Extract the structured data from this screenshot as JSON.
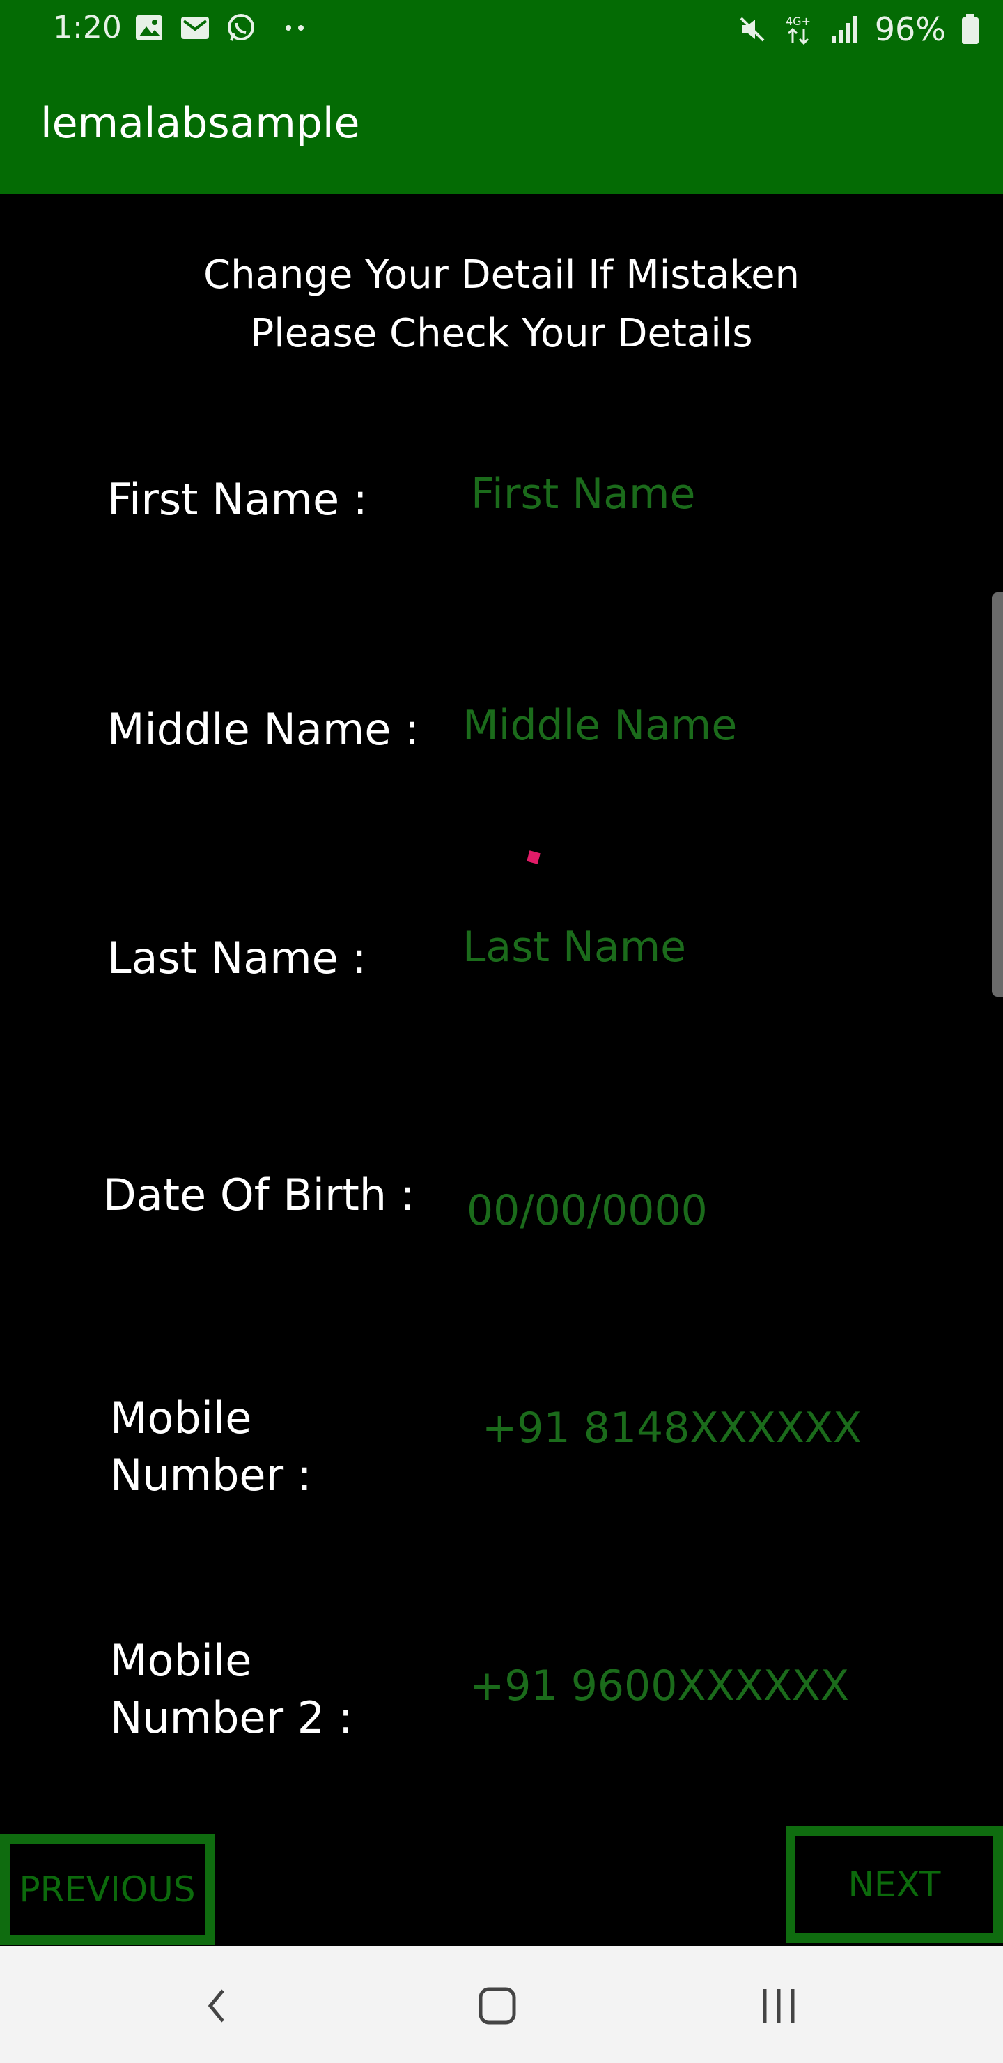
{
  "status_bar": {
    "time": "1:20",
    "battery": "96%"
  },
  "app_bar": {
    "title": "lemalabsample"
  },
  "header": {
    "line1": "Change Your Detail If Mistaken",
    "line2": "Please Check Your Details"
  },
  "form": {
    "first_name_label": "First Name :",
    "first_name_placeholder": "First Name",
    "middle_name_label": "Middle Name :",
    "middle_name_placeholder": "Middle Name",
    "last_name_label": "Last Name :",
    "last_name_placeholder": "Last Name",
    "dob_label": "Date Of Birth :",
    "dob_placeholder": "00/00/0000",
    "mobile_label_line1": "Mobile",
    "mobile_label_line2": "Number :",
    "mobile_placeholder": "+91 8148XXXXXX",
    "mobile2_label_line1": "Mobile",
    "mobile2_label_line2": "Number 2 :",
    "mobile2_placeholder": "+91 9600XXXXXX"
  },
  "buttons": {
    "previous": "PREVIOUS",
    "next": "NEXT"
  },
  "colors": {
    "app_bar": "#046b04",
    "field_text": "#1b6b1b",
    "button_border": "#0f6c0f",
    "background": "#000000"
  },
  "icons": {
    "status_left": [
      "image-icon",
      "gmail-icon",
      "whatsapp-icon",
      "more-dots-icon"
    ],
    "status_right": [
      "mute-icon",
      "4g-data-icon",
      "signal-icon",
      "battery-icon"
    ],
    "nav": [
      "back-icon",
      "home-icon",
      "recents-icon"
    ]
  }
}
